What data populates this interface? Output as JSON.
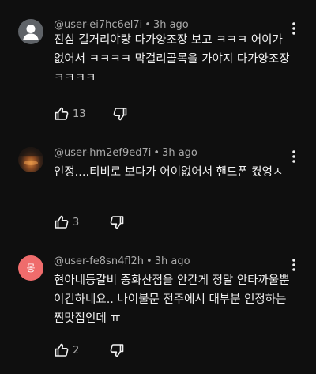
{
  "comments": [
    {
      "author": "@user-ei7hc6el7i",
      "time": "3h ago",
      "text": "진심 길거리야랑 다가양조장 보고 ㅋㅋㅋ 어이가없어서 ㅋㅋㅋㅋ 막걸리골목을 가야지 다가양조장 ㅋㅋㅋㅋ",
      "likes": "13",
      "avatar": "default-profile-icon"
    },
    {
      "author": "@user-hm2ef9ed7i",
      "time": "3h ago",
      "text": "인정....티비로 보다가 어이없어서 핸드폰 켰엉ㅅ",
      "likes": "3",
      "avatar": "photo"
    },
    {
      "author": "@user-fe8sn4fl2h",
      "time": "3h ago",
      "text": "현아네등갈비 중화산점을 안간게 정말 안타까울뿐이긴하네요.. 나이불문 전주에서 대부분 인정하는 찐맛집인데 ㅠ",
      "likes": "2",
      "avatar_letter": "몽",
      "avatar_color": "#ef6c6c"
    }
  ],
  "separator": "•",
  "icons": {
    "like": "thumbs-up-icon",
    "dislike": "thumbs-down-icon",
    "more": "more-vertical-icon"
  }
}
